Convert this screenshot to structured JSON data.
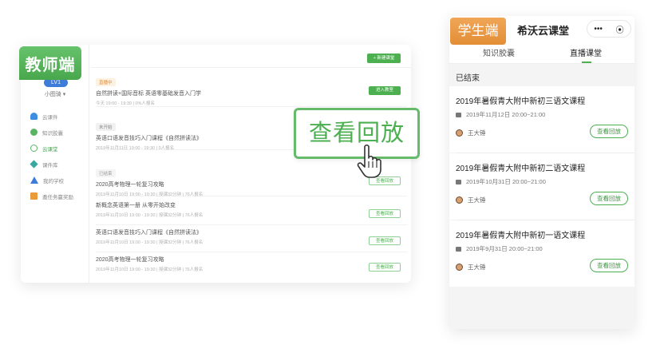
{
  "teacher": {
    "badge": "教师端",
    "level": "LV1",
    "username": "小图骑 ▾",
    "new_button": "+ 新建课堂",
    "menu": [
      {
        "label": "云课件",
        "icon": "cloud-icon"
      },
      {
        "label": "知识胶囊",
        "icon": "capsule-icon"
      },
      {
        "label": "云课堂",
        "icon": "classroom-icon",
        "active": true
      },
      {
        "label": "课件库",
        "icon": "library-icon"
      },
      {
        "label": "我的学校",
        "icon": "school-icon"
      },
      {
        "label": "邀任务赢奖励",
        "icon": "gift-icon"
      }
    ],
    "rows": [
      {
        "tag": "直播中",
        "title": "自然拼读+国际音标 英语零基础发音入门学",
        "meta": "今天 19:00 - 19:30   |   0%人报名",
        "button": "进入教室"
      },
      {
        "tag": "未开始",
        "title": "英语口语发音技巧入门课程《自然拼读法》",
        "meta": "2019年11月11日 19:00 - 19:30   |   0人报名",
        "button": ""
      },
      {
        "tag": "已结束",
        "title": "2020高考物理一轮复习攻略",
        "meta": "2019年11月10日 19:00 - 19:30   |   授课32分钟   |   76人报名",
        "button": "查看回放"
      },
      {
        "tag": "",
        "title": "新概念英语第一册 从零开始改变",
        "meta": "2019年11月10日 19:00 - 19:30   |   授课32分钟   |   76人报名",
        "button": "查看回放"
      },
      {
        "tag": "",
        "title": "英语口语发音技巧入门课程《自然拼读法》",
        "meta": "2019年11月10日 19:00 - 19:30   |   授课32分钟   |   76人报名",
        "button": "查看回放"
      },
      {
        "tag": "",
        "title": "2020高考物理一轮复习攻略",
        "meta": "2019年11月10日 19:00 - 19:30   |   授课32分钟   |   76人报名",
        "button": "查看回放"
      }
    ],
    "callout": "查看回放"
  },
  "student": {
    "badge": "学生端",
    "app_title": "希沃云课堂",
    "capsule_more": "•••",
    "capsule_close": "⦿",
    "tabs": [
      {
        "label": "知识胶囊"
      },
      {
        "label": "直播课堂",
        "active": true
      }
    ],
    "section": "已结束",
    "cards": [
      {
        "title": "2019年暑假青大附中新初三语文课程",
        "time": "2019年11月12日 20:00~21:00",
        "teacher": "王大锤",
        "button": "查看回放"
      },
      {
        "title": "2019年暑假青大附中新初二语文课程",
        "time": "2019年10月31日 20:00~21:00",
        "teacher": "王大锤",
        "button": "查看回放"
      },
      {
        "title": "2019年暑假青大附中新初一语文课程",
        "time": "2019年9月31日 20:00~21:00",
        "teacher": "王大锤",
        "button": "查看回放"
      }
    ]
  },
  "colors": {
    "green": "#4caf50",
    "orange": "#e8963e",
    "blue": "#3d7cd9"
  }
}
